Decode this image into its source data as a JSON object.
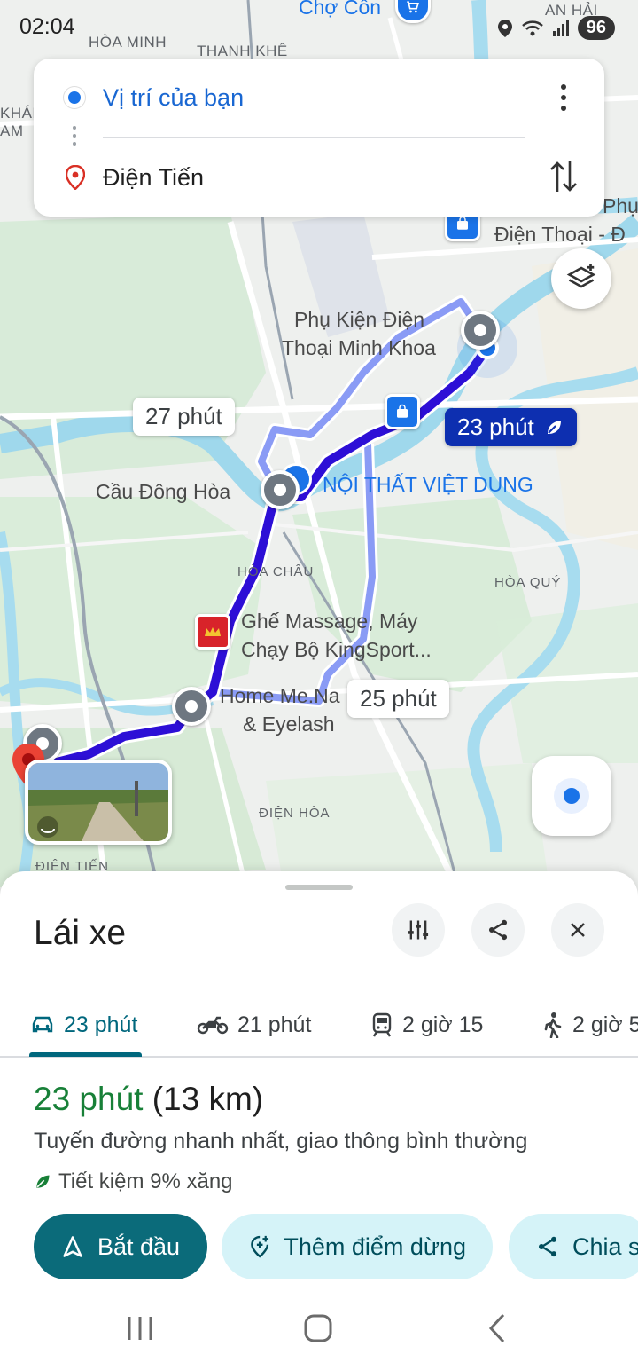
{
  "status_bar": {
    "time": "02:04",
    "battery": "96"
  },
  "map": {
    "area_labels": [
      {
        "id": "hoa-minh",
        "text": "HÒA MINH"
      },
      {
        "id": "thanh-khe",
        "text": "THANH KHÊ"
      },
      {
        "id": "an-hai",
        "text": "AN HẢI"
      },
      {
        "id": "hoa-chau",
        "text": "HÒA CHÂU"
      },
      {
        "id": "hoa-quy",
        "text": "HÒA QUÝ"
      },
      {
        "id": "dien-hoa",
        "text": "ĐIỆN HÒA"
      },
      {
        "id": "dien-tien",
        "text": "ĐIỆN TIẾN"
      },
      {
        "id": "khan",
        "text": "KHÁN"
      },
      {
        "id": "am",
        "text": "AM"
      }
    ],
    "poi": {
      "cho_con": "Chợ Cồn",
      "phu_kien_top_1": "Phụ",
      "phu_kien_top_2": "Điện Thoại - Đ",
      "minh_khoa_1": "Phụ Kiện Điện",
      "minh_khoa_2": "Thoại Minh Khoa",
      "cau_dong_hoa": "Cầu Đông Hòa",
      "noi_that": "NỘI THẤT VIỆT DUNG",
      "kingsport_1": "Ghế Massage, Máy",
      "kingsport_2": "Chạy Bộ KingSport...",
      "home_me_1": "Home Me.Na",
      "home_me_2": "& Eyelash"
    },
    "route_chips": {
      "primary": "23 phút",
      "alt1": "27 phút",
      "alt2": "25 phút"
    },
    "colors": {
      "primary_route": "#2d0fd6",
      "alt_route": "#8a9bf5",
      "water": "#9fd8ec",
      "green": "#c6e7c8"
    }
  },
  "route_card": {
    "origin": "Vị trí của bạn",
    "destination": "Điện Tiến"
  },
  "sheet": {
    "title": "Lái xe",
    "tabs": [
      {
        "id": "car",
        "label": "23 phút",
        "icon": "car-icon"
      },
      {
        "id": "motorbike",
        "label": "21 phút",
        "icon": "motorbike-icon"
      },
      {
        "id": "transit",
        "label": "2 giờ 15",
        "icon": "train-icon"
      },
      {
        "id": "walk",
        "label": "2 giờ 5",
        "icon": "walk-icon"
      }
    ],
    "summary_duration": "23 phút",
    "summary_distance": "(13 km)",
    "route_description": "Tuyến đường nhanh nhất, giao thông bình thường",
    "fuel_saving": "Tiết kiệm 9% xăng",
    "actions": {
      "start": "Bắt đầu",
      "add_stop": "Thêm điểm dừng",
      "share": "Chia s"
    },
    "accent_color": "#0b6b7a"
  }
}
